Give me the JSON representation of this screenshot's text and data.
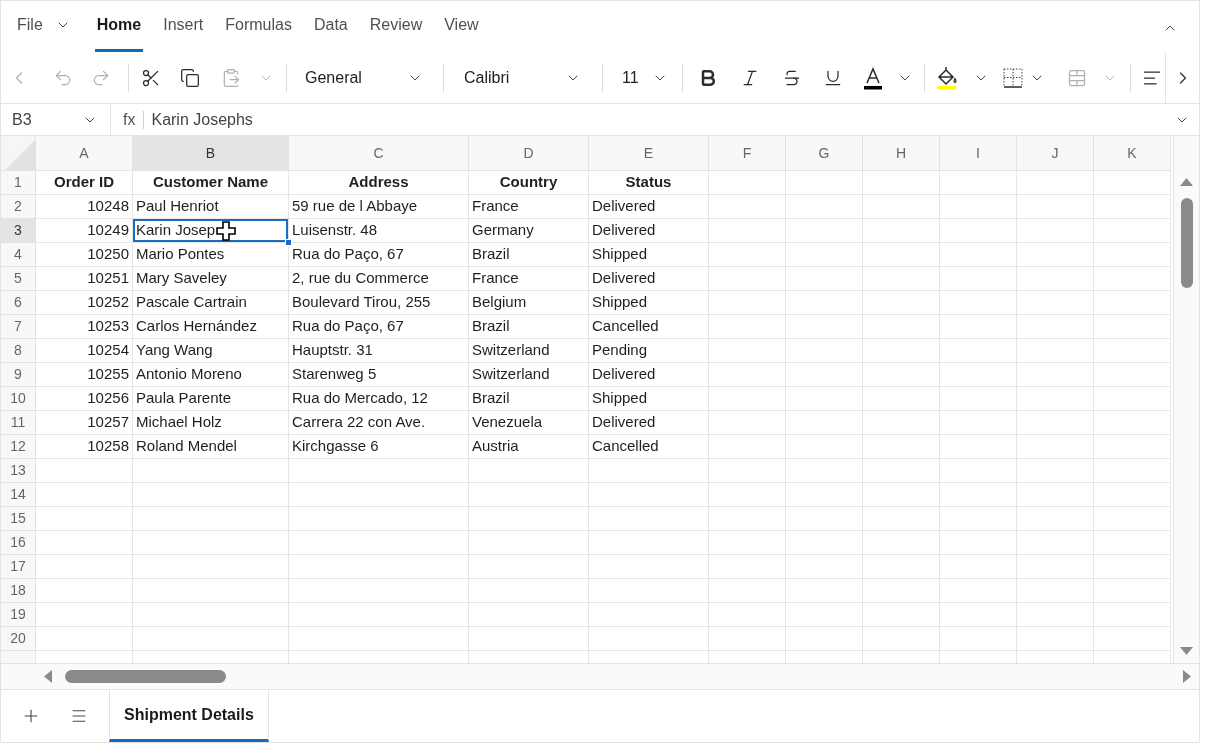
{
  "ribbon": {
    "tabs": [
      {
        "label": "File",
        "selected": false,
        "kind": "menu"
      },
      {
        "label": "Home",
        "selected": true,
        "kind": "tab"
      },
      {
        "label": "Insert",
        "selected": false,
        "kind": "tab"
      },
      {
        "label": "Formulas",
        "selected": false,
        "kind": "tab"
      },
      {
        "label": "Data",
        "selected": false,
        "kind": "tab"
      },
      {
        "label": "Review",
        "selected": false,
        "kind": "tab"
      },
      {
        "label": "View",
        "selected": false,
        "kind": "tab"
      }
    ]
  },
  "toolbar": {
    "back": {
      "disabled": true
    },
    "undo": {
      "disabled": true
    },
    "redo": {
      "disabled": true
    },
    "cut": {
      "disabled": false
    },
    "copy": {
      "disabled": false
    },
    "paste": {
      "disabled": true
    },
    "number_format": "General",
    "font_name": "Calibri",
    "font_size": "11",
    "font_color": {
      "color": "#000000"
    },
    "fill_color": {
      "color": "#ffff00"
    },
    "merge": {
      "disabled": true
    }
  },
  "formula_bar": {
    "cell_ref": "B3",
    "function_label": "fx",
    "value": "Karin Josephs"
  },
  "grid": {
    "columns": [
      {
        "label": "A",
        "selected": false
      },
      {
        "label": "B",
        "selected": true
      },
      {
        "label": "C",
        "selected": false
      },
      {
        "label": "D",
        "selected": false
      },
      {
        "label": "E",
        "selected": false
      },
      {
        "label": "F",
        "selected": false
      },
      {
        "label": "G",
        "selected": false
      },
      {
        "label": "H",
        "selected": false
      },
      {
        "label": "I",
        "selected": false
      },
      {
        "label": "J",
        "selected": false
      },
      {
        "label": "K",
        "selected": false
      }
    ],
    "rows": [
      {
        "number": "1",
        "selected": false,
        "cells": [
          {
            "text": "Order ID",
            "kind": "heading",
            "selected": false
          },
          {
            "text": "Customer Name",
            "kind": "heading",
            "selected": false
          },
          {
            "text": "Address",
            "kind": "heading",
            "selected": false
          },
          {
            "text": "Country",
            "kind": "heading",
            "selected": false
          },
          {
            "text": "Status",
            "kind": "heading",
            "selected": false
          }
        ]
      },
      {
        "number": "2",
        "selected": false,
        "cells": [
          {
            "text": "10248",
            "kind": "number",
            "selected": false
          },
          {
            "text": "Paul Henriot",
            "kind": "text",
            "selected": false
          },
          {
            "text": "59 rue de l Abbaye",
            "kind": "text",
            "selected": false
          },
          {
            "text": "France",
            "kind": "text",
            "selected": false
          },
          {
            "text": "Delivered",
            "kind": "text",
            "selected": false
          }
        ]
      },
      {
        "number": "3",
        "selected": true,
        "cells": [
          {
            "text": "10249",
            "kind": "number",
            "selected": false
          },
          {
            "text": "Karin Josep",
            "kind": "text",
            "selected": true
          },
          {
            "text": "Luisenstr. 48",
            "kind": "text",
            "selected": false
          },
          {
            "text": "Germany",
            "kind": "text",
            "selected": false
          },
          {
            "text": "Delivered",
            "kind": "text",
            "selected": false
          }
        ]
      },
      {
        "number": "4",
        "selected": false,
        "cells": [
          {
            "text": "10250",
            "kind": "number",
            "selected": false
          },
          {
            "text": "Mario Pontes",
            "kind": "text",
            "selected": false
          },
          {
            "text": "Rua do Paço, 67",
            "kind": "text",
            "selected": false
          },
          {
            "text": "Brazil",
            "kind": "text",
            "selected": false
          },
          {
            "text": "Shipped",
            "kind": "text",
            "selected": false
          }
        ]
      },
      {
        "number": "5",
        "selected": false,
        "cells": [
          {
            "text": "10251",
            "kind": "number",
            "selected": false
          },
          {
            "text": "Mary Saveley",
            "kind": "text",
            "selected": false
          },
          {
            "text": "2, rue du Commerce",
            "kind": "text",
            "selected": false
          },
          {
            "text": "France",
            "kind": "text",
            "selected": false
          },
          {
            "text": "Delivered",
            "kind": "text",
            "selected": false
          }
        ]
      },
      {
        "number": "6",
        "selected": false,
        "cells": [
          {
            "text": "10252",
            "kind": "number",
            "selected": false
          },
          {
            "text": "Pascale Cartrain",
            "kind": "text",
            "selected": false
          },
          {
            "text": "Boulevard Tirou, 255",
            "kind": "text",
            "selected": false
          },
          {
            "text": "Belgium",
            "kind": "text",
            "selected": false
          },
          {
            "text": "Shipped",
            "kind": "text",
            "selected": false
          }
        ]
      },
      {
        "number": "7",
        "selected": false,
        "cells": [
          {
            "text": "10253",
            "kind": "number",
            "selected": false
          },
          {
            "text": "Carlos Hernández",
            "kind": "text",
            "selected": false
          },
          {
            "text": "Rua do Paço, 67",
            "kind": "text",
            "selected": false
          },
          {
            "text": "Brazil",
            "kind": "text",
            "selected": false
          },
          {
            "text": "Cancelled",
            "kind": "text",
            "selected": false
          }
        ]
      },
      {
        "number": "8",
        "selected": false,
        "cells": [
          {
            "text": "10254",
            "kind": "number",
            "selected": false
          },
          {
            "text": "Yang Wang",
            "kind": "text",
            "selected": false
          },
          {
            "text": "Hauptstr. 31",
            "kind": "text",
            "selected": false
          },
          {
            "text": "Switzerland",
            "kind": "text",
            "selected": false
          },
          {
            "text": "Pending",
            "kind": "text",
            "selected": false
          }
        ]
      },
      {
        "number": "9",
        "selected": false,
        "cells": [
          {
            "text": "10255",
            "kind": "number",
            "selected": false
          },
          {
            "text": "Antonio Moreno",
            "kind": "text",
            "selected": false
          },
          {
            "text": "Starenweg 5",
            "kind": "text",
            "selected": false
          },
          {
            "text": "Switzerland",
            "kind": "text",
            "selected": false
          },
          {
            "text": "Delivered",
            "kind": "text",
            "selected": false
          }
        ]
      },
      {
        "number": "10",
        "selected": false,
        "cells": [
          {
            "text": "10256",
            "kind": "number",
            "selected": false
          },
          {
            "text": "Paula Parente",
            "kind": "text",
            "selected": false
          },
          {
            "text": "Rua do Mercado, 12",
            "kind": "text",
            "selected": false
          },
          {
            "text": "Brazil",
            "kind": "text",
            "selected": false
          },
          {
            "text": "Shipped",
            "kind": "text",
            "selected": false
          }
        ]
      },
      {
        "number": "11",
        "selected": false,
        "cells": [
          {
            "text": "10257",
            "kind": "number",
            "selected": false
          },
          {
            "text": "Michael Holz",
            "kind": "text",
            "selected": false
          },
          {
            "text": "Carrera 22 con Ave.",
            "kind": "text",
            "selected": false
          },
          {
            "text": "Venezuela",
            "kind": "text",
            "selected": false
          },
          {
            "text": "Delivered",
            "kind": "text",
            "selected": false
          }
        ]
      },
      {
        "number": "12",
        "selected": false,
        "cells": [
          {
            "text": "10258",
            "kind": "number",
            "selected": false
          },
          {
            "text": "Roland Mendel",
            "kind": "text",
            "selected": false
          },
          {
            "text": "Kirchgasse 6",
            "kind": "text",
            "selected": false
          },
          {
            "text": "Austria",
            "kind": "text",
            "selected": false
          },
          {
            "text": "Cancelled",
            "kind": "text",
            "selected": false
          }
        ]
      },
      {
        "number": "13",
        "selected": false
      },
      {
        "number": "14",
        "selected": false
      },
      {
        "number": "15",
        "selected": false
      },
      {
        "number": "16",
        "selected": false
      },
      {
        "number": "17",
        "selected": false
      },
      {
        "number": "18",
        "selected": false
      },
      {
        "number": "19",
        "selected": false
      },
      {
        "number": "20",
        "selected": false
      }
    ]
  },
  "sheet_tabs": [
    {
      "label": "Shipment Details",
      "selected": true
    }
  ]
}
